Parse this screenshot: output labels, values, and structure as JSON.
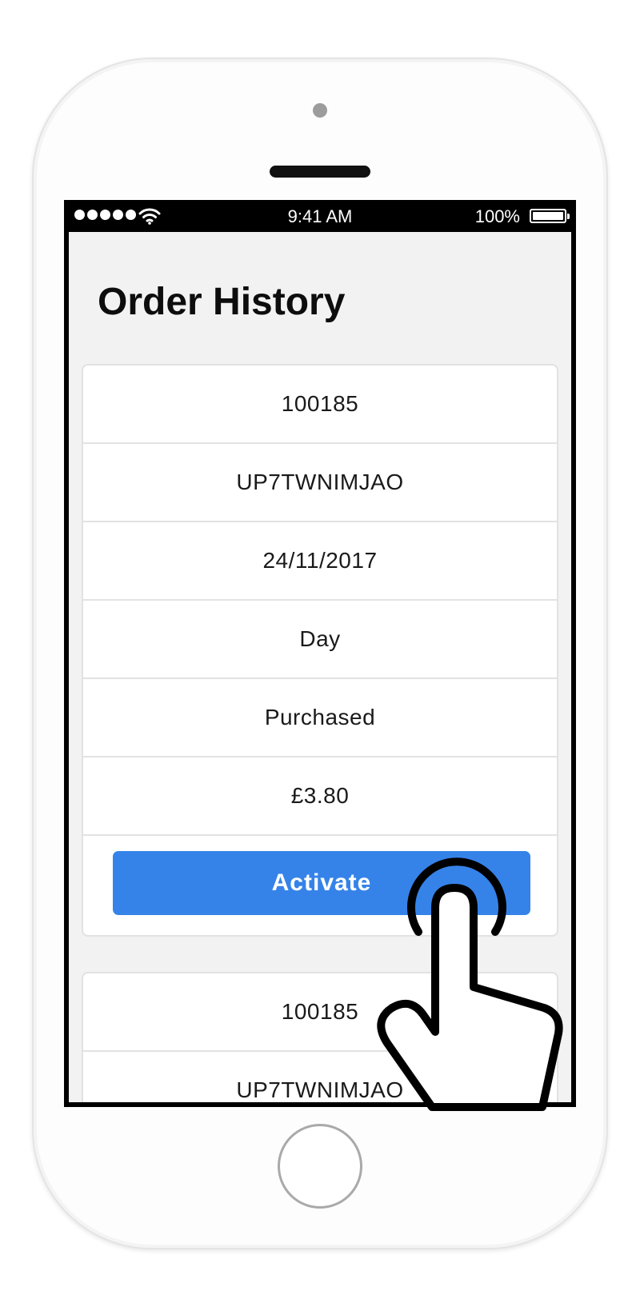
{
  "status_bar": {
    "time": "9:41 AM",
    "battery_percent": "100%",
    "signal_bars": 5,
    "icons": [
      "signal-dots-icon",
      "wifi-icon",
      "battery-icon"
    ]
  },
  "page": {
    "title": "Order History"
  },
  "orders": [
    {
      "order_number": "100185",
      "code": "UP7TWNIMJAO",
      "date": "24/11/2017",
      "ticket_type": "Day",
      "status": "Purchased",
      "price": "£3.80",
      "action_label": "Activate"
    },
    {
      "order_number": "100185",
      "code": "UP7TWNIMJAO"
    }
  ],
  "colors": {
    "accent": "#3583e9",
    "app_background": "#f2f2f2",
    "card_background": "#ffffff",
    "divider": "#e2e2e2"
  },
  "overlay": {
    "icon": "tap-gesture-hand-icon"
  }
}
